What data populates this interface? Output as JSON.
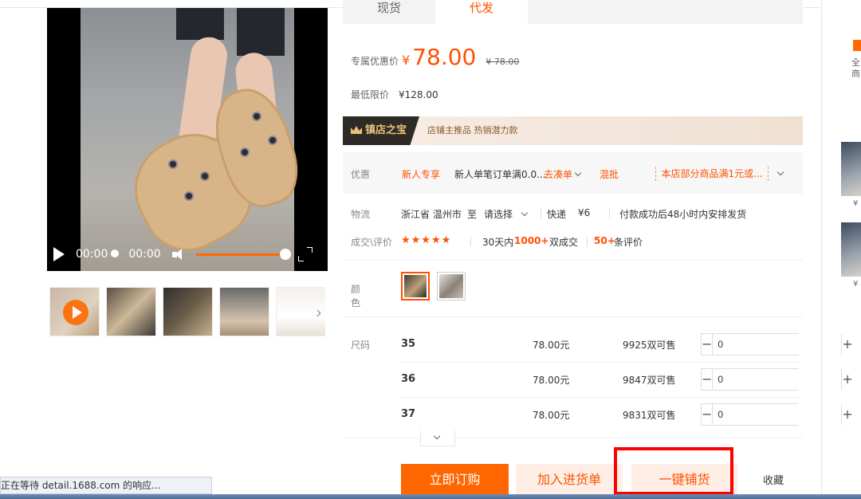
{
  "tabs": [
    {
      "label": "现货"
    },
    {
      "label": "代发"
    }
  ],
  "video": {
    "current_time": "00:00",
    "duration": "00:00",
    "progress": 1.0
  },
  "price": {
    "label": "专属优惠价",
    "currency": "¥",
    "value": "78.00",
    "original": "¥ 78.00"
  },
  "min_price": {
    "label": "最低限价",
    "value": "¥128.00"
  },
  "treasure": {
    "badge": "镇店之宝",
    "text": "店铺主推品  热销潜力款"
  },
  "promo": {
    "label": "优惠",
    "new_user": "新人专享",
    "desc": "新人单笔订单满0.0...",
    "go": "去凑单",
    "mix": "混批",
    "coupon": "本店部分商品满1元或..."
  },
  "logistics": {
    "label": "物流",
    "origin": "浙江省 温州市",
    "to": "至",
    "dest": "请选择",
    "method": "快递",
    "fee": "¥6",
    "ship": "付款成功后48小时内安排发货"
  },
  "deal": {
    "label": "成交\\评价",
    "stars": "★★★★★",
    "days": "30天内",
    "count": "1000+",
    "count_unit": "双成交",
    "reviews": "50+",
    "reviews_unit": "条评价"
  },
  "color": {
    "label": "颜色"
  },
  "sizes": {
    "label": "尺码",
    "rows": [
      {
        "size": "35",
        "price": "78.00元",
        "stock": "9925双可售",
        "qty": "0"
      },
      {
        "size": "36",
        "price": "78.00元",
        "stock": "9847双可售",
        "qty": "0"
      },
      {
        "size": "37",
        "price": "78.00元",
        "stock": "9831双可售",
        "qty": "0"
      }
    ]
  },
  "actions": {
    "buy": "立即订购",
    "cart": "加入进货单",
    "distribute": "一键铺货",
    "favorite": "收藏"
  },
  "sidebar": {
    "text": "全商",
    "price1": "¥",
    "price2": "¥"
  },
  "status_bar": "正在等待 detail.1688.com 的响应...",
  "colors": {
    "accent": "#ff5000",
    "buy_button": "#ff6600",
    "highlight_box": "#ff0000"
  }
}
